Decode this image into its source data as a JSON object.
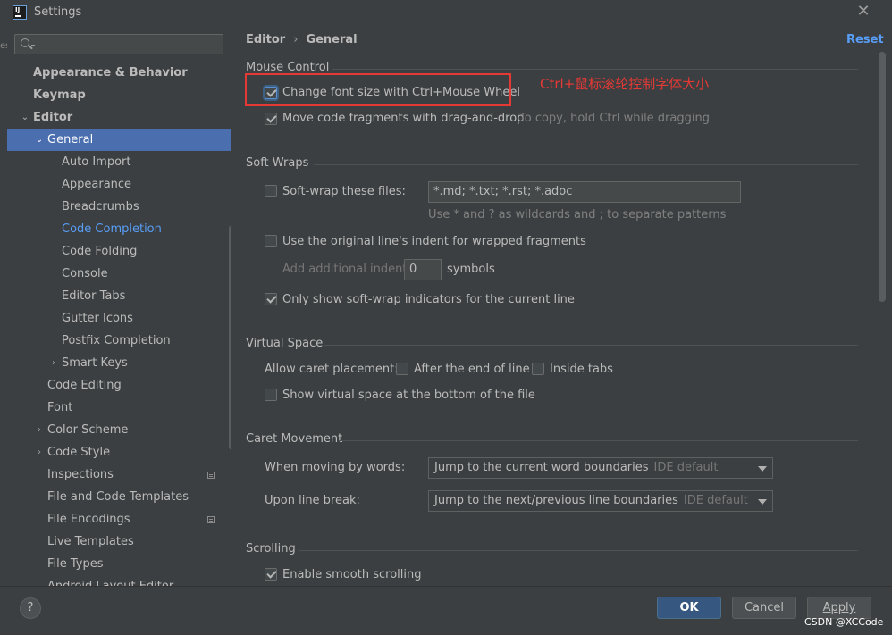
{
  "window": {
    "title": "Settings",
    "close_glyph": "✕"
  },
  "search": {
    "placeholder": ""
  },
  "sidebar": {
    "items": [
      {
        "label": "Appearance & Behavior",
        "arrow": "",
        "bold": true
      },
      {
        "label": "Keymap",
        "arrow": "",
        "bold": true
      },
      {
        "label": "Editor",
        "arrow": "⌄",
        "bold": true
      },
      {
        "label": "General",
        "arrow": "⌄",
        "selected": true
      },
      {
        "label": "Auto Import"
      },
      {
        "label": "Appearance"
      },
      {
        "label": "Breadcrumbs"
      },
      {
        "label": "Code Completion",
        "link": true
      },
      {
        "label": "Code Folding"
      },
      {
        "label": "Console"
      },
      {
        "label": "Editor Tabs"
      },
      {
        "label": "Gutter Icons"
      },
      {
        "label": "Postfix Completion"
      },
      {
        "label": "Smart Keys",
        "arrow": "›"
      },
      {
        "label": "Code Editing"
      },
      {
        "label": "Font"
      },
      {
        "label": "Color Scheme",
        "arrow": "›"
      },
      {
        "label": "Code Style",
        "arrow": "›"
      },
      {
        "label": "Inspections",
        "icon": "project-settings-icon"
      },
      {
        "label": "File and Code Templates"
      },
      {
        "label": "File Encodings",
        "icon": "project-settings-icon"
      },
      {
        "label": "Live Templates"
      },
      {
        "label": "File Types"
      },
      {
        "label": "Android Layout Editor"
      }
    ]
  },
  "breadcrumb": {
    "part1": "Editor",
    "separator": "›",
    "part2": "General"
  },
  "reset_label": "Reset",
  "sections": {
    "mouse": {
      "title": "Mouse Control",
      "change_font": {
        "label": "Change font size with Ctrl+Mouse Wheel",
        "checked": true
      },
      "drag_drop": {
        "label": "Move code fragments with drag-and-drop",
        "checked": true,
        "hint": "To copy, hold Ctrl while dragging"
      }
    },
    "soft_wraps": {
      "title": "Soft Wraps",
      "soft_wrap_files": {
        "label": "Soft-wrap these files:",
        "checked": false,
        "value": "*.md; *.txt; *.rst; *.adoc"
      },
      "patterns_hint": "Use * and ? as wildcards and ; to separate patterns",
      "original_indent": {
        "label": "Use the original line's indent for wrapped fragments",
        "checked": false
      },
      "additional_indent": {
        "label": "Add additional indent:",
        "value": "0",
        "suffix": "symbols"
      },
      "indicators": {
        "label": "Only show soft-wrap indicators for the current line",
        "checked": true
      }
    },
    "virtual_space": {
      "title": "Virtual Space",
      "caret_label": "Allow caret placement:",
      "after_end": {
        "label": "After the end of line",
        "checked": false
      },
      "inside_tabs": {
        "label": "Inside tabs",
        "checked": false
      },
      "show_bottom": {
        "label": "Show virtual space at the bottom of the file",
        "checked": false
      }
    },
    "caret": {
      "title": "Caret Movement",
      "words_label": "When moving by words:",
      "words_value": "Jump to the current word boundaries",
      "words_default": "IDE default",
      "break_label": "Upon line break:",
      "break_value": "Jump to the next/previous line boundaries",
      "break_default": "IDE default"
    },
    "scrolling": {
      "title": "Scrolling",
      "smooth": {
        "label": "Enable smooth scrolling",
        "checked": true
      }
    }
  },
  "annotation": {
    "text": "Ctrl+鼠标滚轮控制字体大小",
    "color": "#e53935"
  },
  "footer": {
    "help_glyph": "?",
    "ok_label": "OK",
    "cancel_label": "Cancel",
    "apply_label": "Apply",
    "watermark": "CSDN @XCCode"
  },
  "colors": {
    "accent": "#4b6eaf",
    "link": "#589df6",
    "primary_button": "#365880",
    "background": "#3c3f41"
  }
}
